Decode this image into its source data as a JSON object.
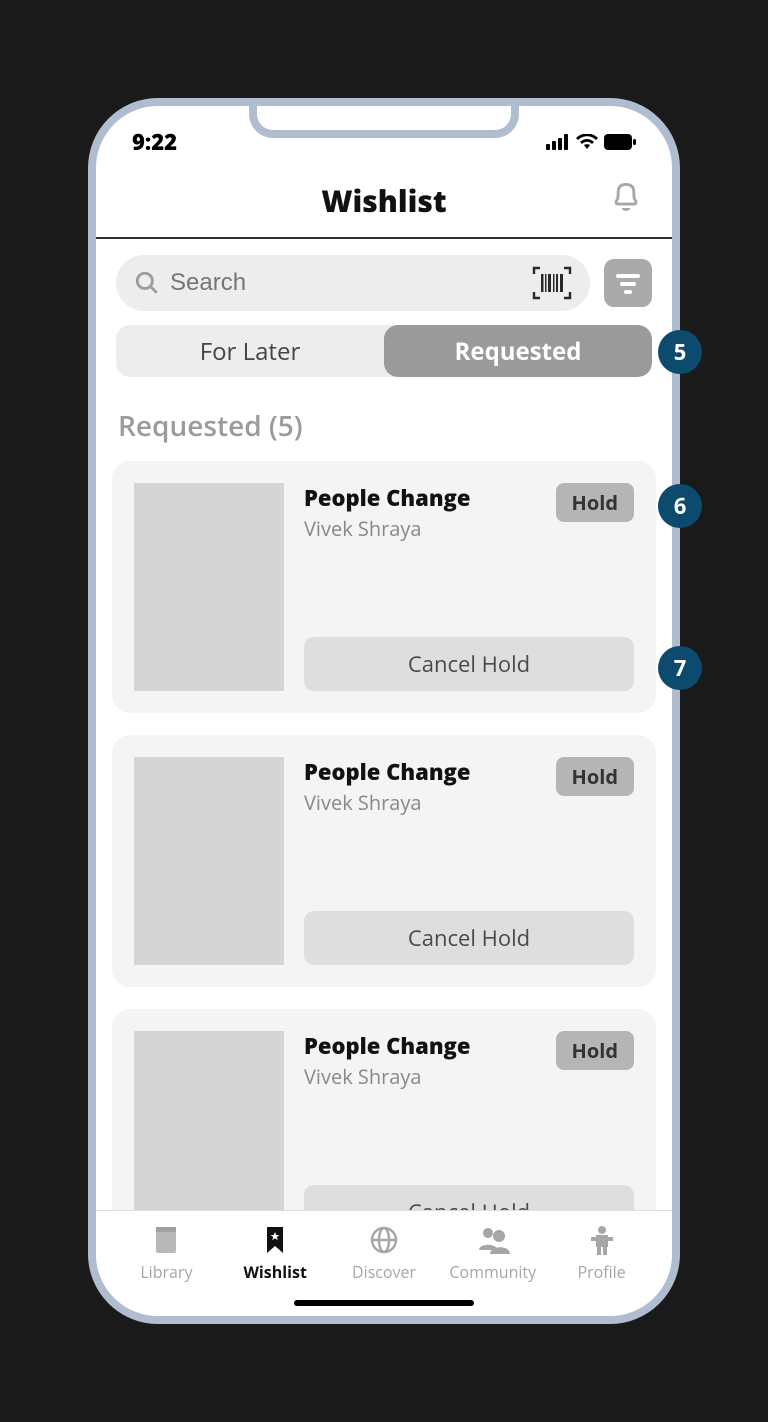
{
  "status_bar": {
    "time": "9:22"
  },
  "header": {
    "title": "Wishlist"
  },
  "search": {
    "placeholder": "Search"
  },
  "segmented": {
    "for_later": "For Later",
    "requested": "Requested"
  },
  "section": {
    "label": "Requested (5)"
  },
  "items": [
    {
      "title": "People Change",
      "author": "Vivek Shraya",
      "status": "Hold",
      "cancel": "Cancel Hold"
    },
    {
      "title": "People Change",
      "author": "Vivek Shraya",
      "status": "Hold",
      "cancel": "Cancel Hold"
    },
    {
      "title": "People Change",
      "author": "Vivek Shraya",
      "status": "Hold",
      "cancel": "Cancel Hold"
    }
  ],
  "tabs": {
    "library": "Library",
    "wishlist": "Wishlist",
    "discover": "Discover",
    "community": "Community",
    "profile": "Profile"
  },
  "callouts": {
    "a": "5",
    "b": "6",
    "c": "7"
  },
  "colors": {
    "accent": "#0d4b6e"
  }
}
